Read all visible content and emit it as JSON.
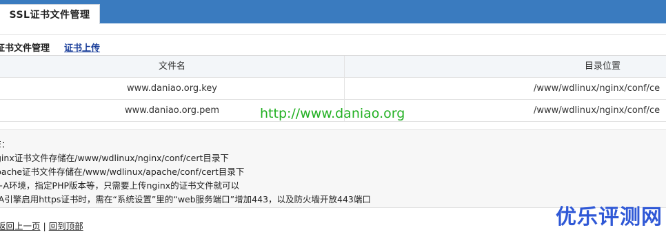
{
  "tabs": {
    "active_label": "SSL证书文件管理"
  },
  "subnav": {
    "current_label": "证书文件管理",
    "upload_label": "证书上传"
  },
  "table": {
    "columns": [
      "文件名",
      "目录位置"
    ],
    "rows": [
      {
        "name": "www.daniao.org.key",
        "path": "/www/wdlinux/nginx/conf/ce"
      },
      {
        "name": "www.daniao.org.pem",
        "path": "/www/wdlinux/nginx/conf/ce"
      }
    ]
  },
  "watermark": "http://www.daniao.org",
  "notes": [
    "E：",
    "ginx证书文件存储在/www/wdlinux/nginx/conf/cert目录下",
    "pache证书文件存储在/www/wdlinux/apache/conf/cert目录下",
    "+A环境，指定PHP版本等，只需要上传nginx的证书文件就可以",
    "IA引擎启用https证书时，需在“系统设置”里的“web服务端口”增加443，以及防火墙开放443端口"
  ],
  "footer": {
    "back_label": "返回上一页",
    "separator": "|",
    "top_label": "回到顶部"
  },
  "logo_text": "优乐评测网",
  "colors": {
    "header_bar": "#3a7bbf",
    "link": "#1a3e9a",
    "watermark": "#22b022",
    "logo": "#2f58d6"
  }
}
